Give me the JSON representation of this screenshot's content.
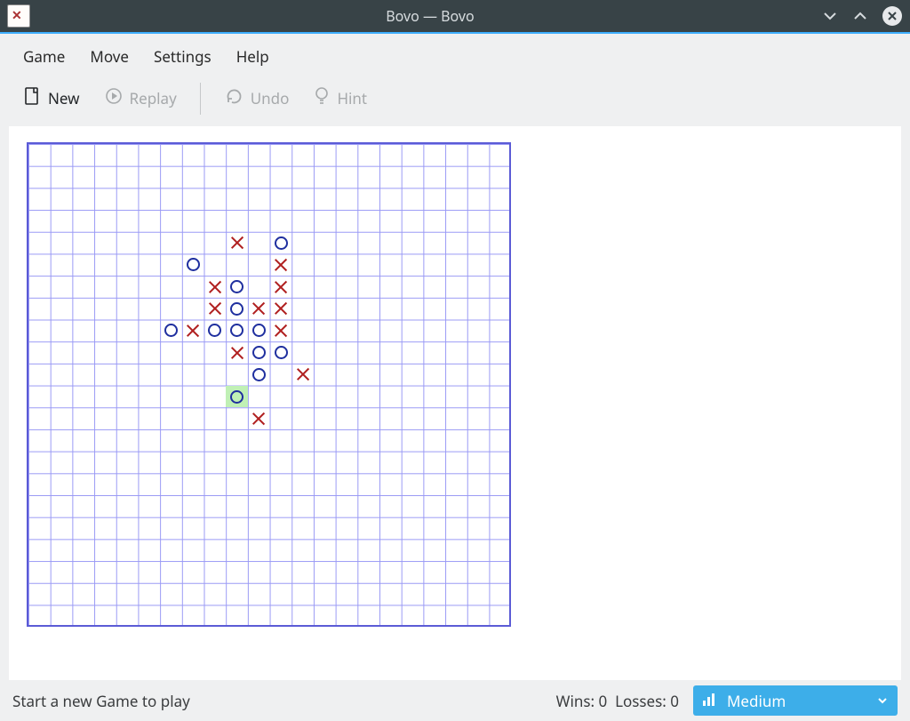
{
  "window": {
    "title": "Bovo — Bovo"
  },
  "menubar": [
    "Game",
    "Move",
    "Settings",
    "Help"
  ],
  "toolbar": {
    "new": "New",
    "replay": "Replay",
    "undo": "Undo",
    "hint": "Hint"
  },
  "board": {
    "cols": 22,
    "rows": 22,
    "pieces": [
      {
        "col": 9,
        "row": 4,
        "mark": "x"
      },
      {
        "col": 11,
        "row": 4,
        "mark": "o"
      },
      {
        "col": 7,
        "row": 5,
        "mark": "o"
      },
      {
        "col": 11,
        "row": 5,
        "mark": "x"
      },
      {
        "col": 8,
        "row": 6,
        "mark": "x"
      },
      {
        "col": 9,
        "row": 6,
        "mark": "o"
      },
      {
        "col": 11,
        "row": 6,
        "mark": "x"
      },
      {
        "col": 8,
        "row": 7,
        "mark": "x"
      },
      {
        "col": 9,
        "row": 7,
        "mark": "o"
      },
      {
        "col": 10,
        "row": 7,
        "mark": "x"
      },
      {
        "col": 11,
        "row": 7,
        "mark": "x"
      },
      {
        "col": 6,
        "row": 8,
        "mark": "o"
      },
      {
        "col": 7,
        "row": 8,
        "mark": "x"
      },
      {
        "col": 8,
        "row": 8,
        "mark": "o"
      },
      {
        "col": 9,
        "row": 8,
        "mark": "o"
      },
      {
        "col": 10,
        "row": 8,
        "mark": "o"
      },
      {
        "col": 11,
        "row": 8,
        "mark": "x"
      },
      {
        "col": 9,
        "row": 9,
        "mark": "x"
      },
      {
        "col": 10,
        "row": 9,
        "mark": "o"
      },
      {
        "col": 11,
        "row": 9,
        "mark": "o"
      },
      {
        "col": 10,
        "row": 10,
        "mark": "o"
      },
      {
        "col": 12,
        "row": 10,
        "mark": "x"
      },
      {
        "col": 9,
        "row": 11,
        "mark": "o",
        "highlight": true
      },
      {
        "col": 10,
        "row": 12,
        "mark": "x"
      }
    ]
  },
  "status": {
    "message": "Start a new Game to play",
    "wins_label": "Wins:",
    "wins": 0,
    "losses_label": "Losses:",
    "losses": 0
  },
  "difficulty": {
    "label": "Medium"
  }
}
